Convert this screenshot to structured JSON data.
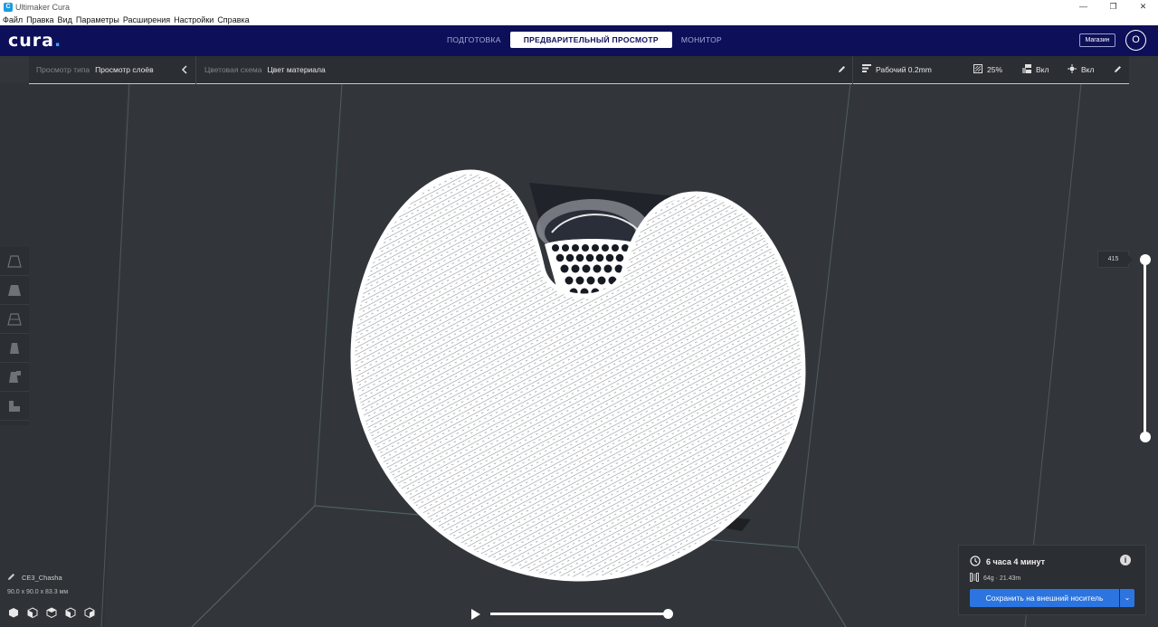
{
  "window": {
    "title": "Ultimaker Cura",
    "app_icon": "cura-app-icon"
  },
  "menu": [
    "Файл",
    "Правка",
    "Вид",
    "Параметры",
    "Расширения",
    "Настройки",
    "Справка"
  ],
  "header": {
    "logo": "cura",
    "stages": [
      "ПОДГОТОВКА",
      "ПРЕДВАРИТЕЛЬНЫЙ ПРОСМОТР",
      "МОНИТОР"
    ],
    "active_stage": "ПРЕДВАРИТЕЛЬНЫЙ ПРОСМОТР",
    "marketplace": "Магазин",
    "account_initial": "O",
    "colors": {
      "header_bg": "#0d0f58",
      "accent": "#2c75e0"
    }
  },
  "toolbar": {
    "view_type_label": "Просмотр типа",
    "view_type_value": "Просмотр слоёв",
    "color_scheme_label": "Цветовая схема",
    "color_scheme_value": "Цвет материала",
    "profile": "Рабочий 0.2mm",
    "infill": "25%",
    "support": "Вкл",
    "adhesion": "Вкл"
  },
  "layer_slider": {
    "current_layer": "415"
  },
  "object": {
    "name": "CE3_Chasha",
    "dimensions": "90.0 x 90.0 x 83.3 мм"
  },
  "print_info": {
    "time": "6 часа 4 минут",
    "material": "64g · 21.43m",
    "save_button": "Сохранить на внешний носитель"
  },
  "playback": {
    "progress": 1.0
  }
}
